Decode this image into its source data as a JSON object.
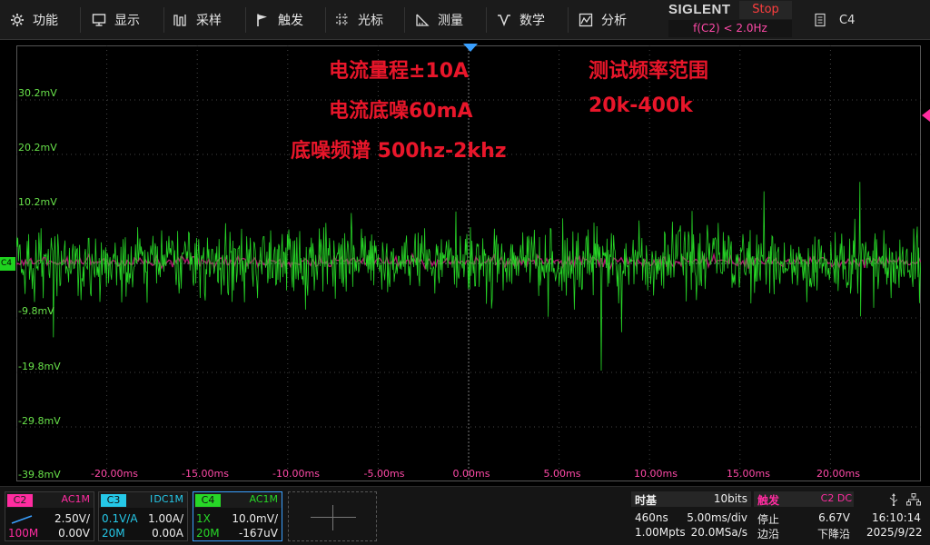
{
  "menu": {
    "items": [
      {
        "id": "function",
        "label": "功能",
        "icon": "gear-icon"
      },
      {
        "id": "display",
        "label": "显示",
        "icon": "monitor-icon"
      },
      {
        "id": "acquire",
        "label": "采样",
        "icon": "acquire-icon"
      },
      {
        "id": "trigger",
        "label": "触发",
        "icon": "flag-icon"
      },
      {
        "id": "cursors",
        "label": "光标",
        "icon": "cursor-icon"
      },
      {
        "id": "measure",
        "label": "测量",
        "icon": "measure-icon"
      },
      {
        "id": "math",
        "label": "数学",
        "icon": "math-icon"
      },
      {
        "id": "analysis",
        "label": "分析",
        "icon": "analysis-icon"
      }
    ]
  },
  "brand": {
    "logo": "SIGLENT",
    "run_state": "Stop",
    "trigger_condition": "f(C2) < 2.0Hz"
  },
  "active_channel_label": "C4",
  "grid": {
    "y_labels": [
      "30.2mV",
      "20.2mV",
      "10.2mV",
      "-9.8mV",
      "-19.8mV",
      "-29.8mV",
      "-39.8mV"
    ],
    "x_labels": [
      "-20.00ms",
      "-15.00ms",
      "-10.00ms",
      "-5.00ms",
      "0.00ms",
      "5.00ms",
      "10.00ms",
      "15.00ms",
      "20.00ms"
    ]
  },
  "annotations": {
    "range": "电流量程±10A",
    "noise_floor": "电流底噪60mA",
    "noise_spectrum": "底噪频谱 500hz-2khz",
    "freq_range_title": "测试频率范围",
    "freq_range_value": "20k-400k"
  },
  "ch4_marker": "C4",
  "channels": [
    {
      "id": "c2",
      "tag": "C2",
      "coupling": "AC1M",
      "r1_left": "",
      "r1_right": "2.50V/",
      "r2_left": "100M",
      "r2_right": "0.00V",
      "color": "#ff2ca0"
    },
    {
      "id": "c3",
      "tag": "C3",
      "coupling": "DC1M",
      "r1_left": "0.1V/A",
      "r1_right": "1.00A/",
      "r2_left": "20M",
      "r2_right": "0.00A",
      "color": "#25c8e8"
    },
    {
      "id": "c4",
      "tag": "C4",
      "coupling": "AC1M",
      "r1_left": "1X",
      "r1_right": "10.0mV/",
      "r2_left": "20M",
      "r2_right": "-167uV",
      "color": "#27d727"
    }
  ],
  "c3_bwl_mark": "I",
  "timebase": {
    "title": "时基",
    "bits": "10bits",
    "delay": "460ns",
    "scale": "5.00ms/div",
    "memory": "1.00Mpts",
    "sample_rate": "20.0MSa/s"
  },
  "trigger": {
    "title": "触发",
    "source": "C2 DC",
    "mode": "停止",
    "level": "6.67V",
    "type": "边沿",
    "slope": "下降沿"
  },
  "system": {
    "time": "16:10:14",
    "date": "2025/9/22"
  },
  "colors": {
    "ch2": "#ff2ca0",
    "ch3": "#25c8e8",
    "ch4": "#27d727",
    "grid_label": "#68e24a",
    "x_label": "#ff4aa8",
    "annotation": "#e8162a",
    "stop": "#ff3e3e"
  }
}
